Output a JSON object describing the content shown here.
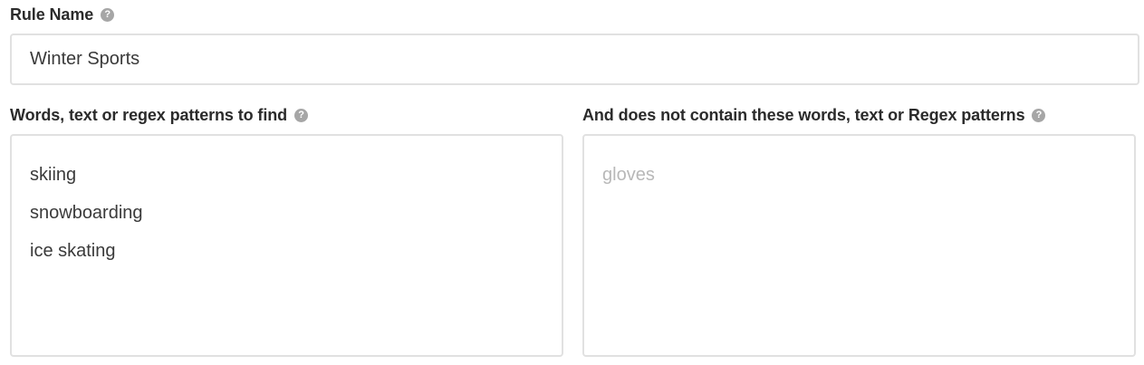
{
  "rule_name": {
    "label": "Rule Name",
    "help_icon": "question-circle-icon",
    "value": "Winter Sports"
  },
  "find_patterns": {
    "label": "Words, text or regex patterns to find",
    "help_icon": "question-circle-icon",
    "lines": [
      "skiing",
      "snowboarding",
      "ice skating"
    ]
  },
  "exclude_patterns": {
    "label": "And does not contain these words, text or Regex patterns",
    "help_icon": "question-circle-icon",
    "placeholder": "gloves",
    "lines": []
  },
  "colors": {
    "border": "#e1e1e1",
    "label_text": "#2b2b2b",
    "input_text": "#3a3a3a",
    "placeholder_text": "#b8b8b8",
    "help_icon_bg": "#a6a6a6"
  }
}
